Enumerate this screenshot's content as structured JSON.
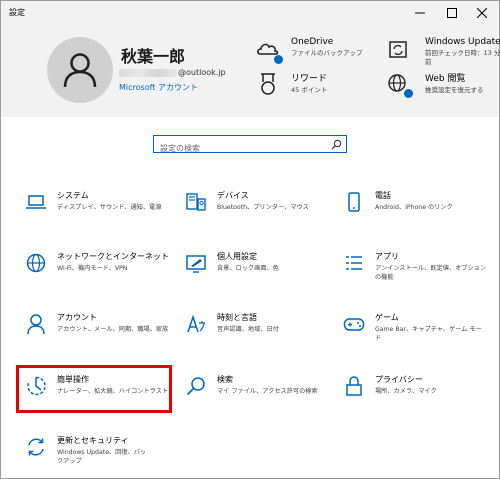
{
  "window": {
    "title": "設定"
  },
  "account": {
    "name": "秋葉一郎",
    "email_domain": "@outlook.jp",
    "account_link": "Microsoft アカウント"
  },
  "header_items": [
    {
      "title": "OneDrive",
      "subtitle": "ファイルのバックアップ",
      "icon": "onedrive-icon"
    },
    {
      "title": "Windows Update",
      "subtitle": "前回チェック日時：13 分前",
      "icon": "windows-update-icon"
    },
    {
      "title": "リワード",
      "subtitle": "45 ポイント",
      "icon": "rewards-icon"
    },
    {
      "title": "Web 閲覧",
      "subtitle": "推奨設定を復元する",
      "icon": "web-browsing-icon"
    }
  ],
  "search": {
    "placeholder": "設定の検索"
  },
  "categories": [
    {
      "title": "システム",
      "desc": "ディスプレイ、サウンド、通知、電源",
      "icon": "laptop-icon"
    },
    {
      "title": "デバイス",
      "desc": "Bluetooth、プリンター、マウス",
      "icon": "devices-icon"
    },
    {
      "title": "電話",
      "desc": "Android、iPhone のリンク",
      "icon": "phone-icon"
    },
    {
      "title": "ネットワークとインターネット",
      "desc": "Wi-Fi、機内モード、VPN",
      "icon": "globe-icon"
    },
    {
      "title": "個人用設定",
      "desc": "背景、ロック画面、色",
      "icon": "personalization-icon"
    },
    {
      "title": "アプリ",
      "desc": "アンインストール、既定値、オプションの機能",
      "icon": "apps-icon"
    },
    {
      "title": "アカウント",
      "desc": "アカウント、メール、同期、職場、家族",
      "icon": "person-icon"
    },
    {
      "title": "時刻と言語",
      "desc": "音声認識、地域、日付",
      "icon": "time-language-icon"
    },
    {
      "title": "ゲーム",
      "desc": "Game Bar、キャプチャ、ゲーム モード",
      "icon": "gamepad-icon"
    },
    {
      "title": "簡単操作",
      "desc": "ナレーター、拡大鏡、ハイコントラスト",
      "icon": "ease-of-access-icon"
    },
    {
      "title": "検索",
      "desc": "マイ ファイル、アクセス許可の検索",
      "icon": "search-icon"
    },
    {
      "title": "プライバシー",
      "desc": "場所、カメラ、マイク",
      "icon": "lock-icon"
    },
    {
      "title": "更新とセキュリティ",
      "desc": "Windows Update、回復、バックアップ",
      "icon": "sync-icon"
    }
  ],
  "colors": {
    "accent": "#0067c0",
    "header_bg": "#f2f2f2",
    "highlight": "#e60000"
  }
}
